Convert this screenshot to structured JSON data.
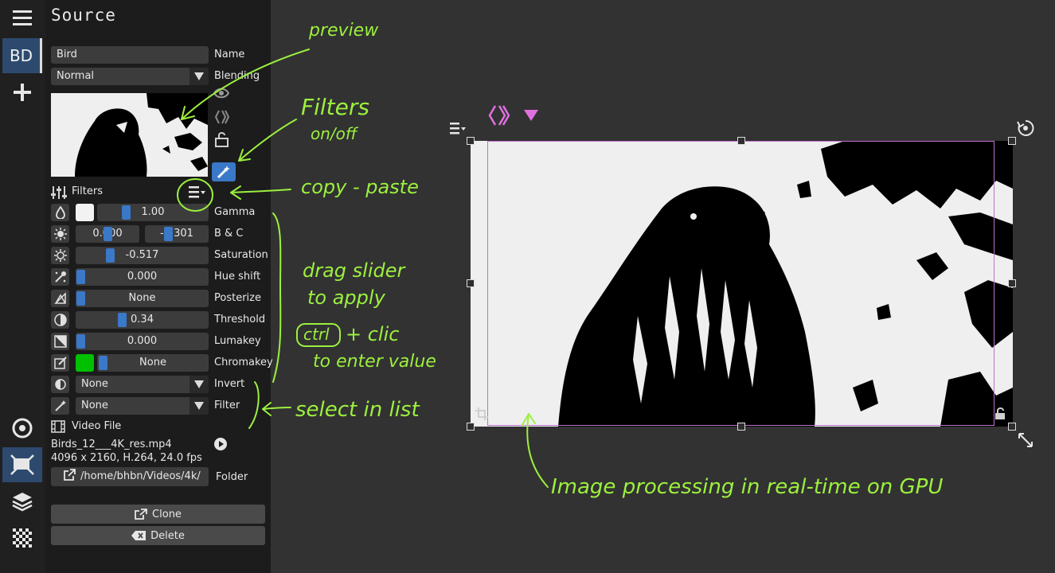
{
  "panel": {
    "title": "Source",
    "name_value": "Bird",
    "name_label": "Name",
    "blending_value": "Normal",
    "blending_label": "Blending",
    "filters_label": "Filters"
  },
  "toolbar": {
    "badge": "BD"
  },
  "filters": [
    {
      "label": "Gamma",
      "value": "1.00"
    },
    {
      "label": "B & C",
      "value": "0.000",
      "value2": "-0.301"
    },
    {
      "label": "Saturation",
      "value": "-0.517"
    },
    {
      "label": "Hue shift",
      "value": "0.000"
    },
    {
      "label": "Posterize",
      "value": "None"
    },
    {
      "label": "Threshold",
      "value": "0.34"
    },
    {
      "label": "Lumakey",
      "value": "0.000"
    },
    {
      "label": "Chromakey",
      "value": "None"
    },
    {
      "label": "Invert",
      "value": "None"
    },
    {
      "label": "Filter",
      "value": "None"
    }
  ],
  "video": {
    "section_label": "Video File",
    "filename": "Birds_12___4K_res.mp4",
    "info": "4096 x 2160, H.264, 24.0 fps",
    "folder_path": "/home/bhbn/Videos/4k/",
    "folder_label": "Folder"
  },
  "actions": {
    "clone": "Clone",
    "delete": "Delete"
  },
  "annotations": {
    "preview": "preview",
    "filters_title": "Filters",
    "filters_sub": "on/off",
    "copy_paste": "copy - paste",
    "drag1": "drag slider",
    "drag2": "to apply",
    "ctrl": "ctrl",
    "clic": "+ clic",
    "enter": "to enter value",
    "select": "select in list",
    "gpu": "Image processing in real-time on GPU"
  },
  "colors": {
    "accent_blue": "#3a78c8",
    "annotation_green": "#9cf03e",
    "selection_magenta": "#c070d0",
    "chromakey_green": "#00c000"
  }
}
